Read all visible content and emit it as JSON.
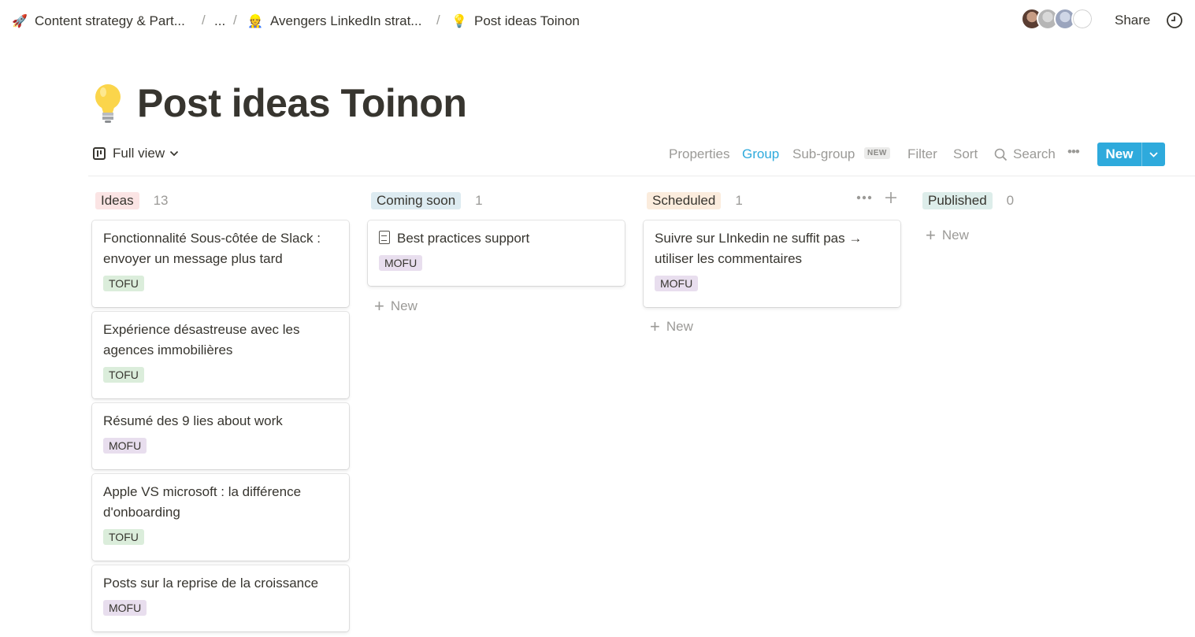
{
  "breadcrumb": [
    {
      "icon": "🚀",
      "label": "Content strategy & Part..."
    },
    {
      "icon": "",
      "label": "..."
    },
    {
      "icon": "👷",
      "label": "Avengers LinkedIn strat..."
    },
    {
      "icon": "💡",
      "label": "Post ideas Toinon"
    }
  ],
  "breadcrumb_separator": "/",
  "header": {
    "share_label": "Share"
  },
  "page": {
    "title": "Post ideas Toinon",
    "icon": "lightbulb-icon"
  },
  "toolbar": {
    "view_label": "Full view",
    "properties": "Properties",
    "group": "Group",
    "subgroup": "Sub-group",
    "subgroup_badge": "NEW",
    "filter": "Filter",
    "sort": "Sort",
    "search": "Search",
    "more": "•••",
    "new_label": "New",
    "accent_color": "#2eaadc"
  },
  "columns": [
    {
      "label": "Ideas",
      "count": "13",
      "color": "#fbe4e4"
    },
    {
      "label": "Coming soon",
      "count": "1",
      "color": "#ddebf1"
    },
    {
      "label": "Scheduled",
      "count": "1",
      "color": "#fbecdd"
    },
    {
      "label": "Published",
      "count": "0",
      "color": "#ddedea"
    }
  ],
  "cards": {
    "ideas": [
      {
        "title": "Fonctionnalité Sous-côtée de Slack : envoyer un message plus tard",
        "tag": "TOFU"
      },
      {
        "title": "Expérience désastreuse avec les agences immobilières",
        "tag": "TOFU"
      },
      {
        "title": "Résumé des 9 lies about work",
        "tag": "MOFU"
      },
      {
        "title": "Apple VS microsoft : la différence d'onboarding",
        "tag": "TOFU"
      },
      {
        "title": "Posts sur la reprise de la croissance",
        "tag": "MOFU"
      }
    ],
    "coming_soon": [
      {
        "title": "Best practices support",
        "tag": "MOFU"
      }
    ],
    "scheduled": [
      {
        "title": "Suivre sur LInkedin ne suffit pas → utiliser les commentaires",
        "tag": "MOFU"
      }
    ]
  },
  "add_new_label": "New"
}
